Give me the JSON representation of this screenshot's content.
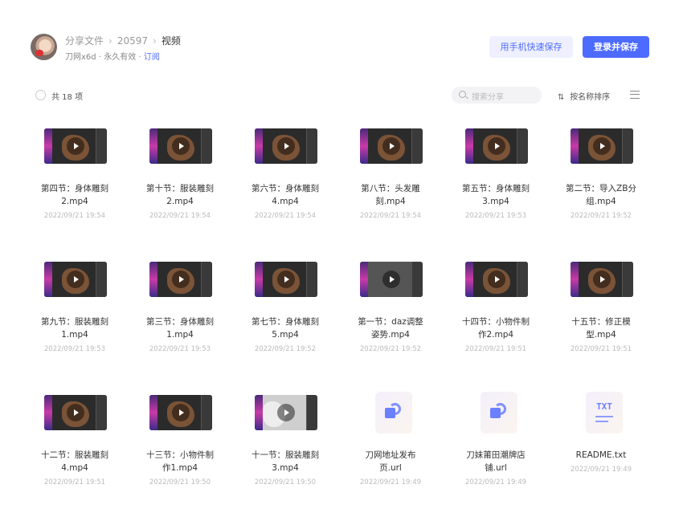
{
  "header": {
    "breadcrumb": [
      "分享文件",
      "20597",
      "视频"
    ],
    "breadcrumb_separator": "›",
    "owner": "刀网x6d",
    "validity": "永久有效",
    "meta_separator": "·",
    "subscribe": "订阅",
    "quick_save_label": "用手机快速保存",
    "save_label": "登录并保存"
  },
  "toolbar": {
    "count_label": "共 18 项",
    "search_placeholder": "搜索分享",
    "sort_icon": "⇅",
    "sort_label": "按名称排序"
  },
  "files": [
    {
      "name_line1": "第四节：身体雕刻",
      "name_line2": "2.mp4",
      "date": "2022/09/21 19:54",
      "type": "video"
    },
    {
      "name_line1": "第十节：服装雕刻",
      "name_line2": "2.mp4",
      "date": "2022/09/21 19:54",
      "type": "video"
    },
    {
      "name_line1": "第六节：身体雕刻",
      "name_line2": "4.mp4",
      "date": "2022/09/21 19:54",
      "type": "video"
    },
    {
      "name_line1": "第八节：头发雕",
      "name_line2": "刻.mp4",
      "date": "2022/09/21 19:54",
      "type": "video"
    },
    {
      "name_line1": "第五节：身体雕刻",
      "name_line2": "3.mp4",
      "date": "2022/09/21 19:53",
      "type": "video"
    },
    {
      "name_line1": "第二节：导入ZB分",
      "name_line2": "组.mp4",
      "date": "2022/09/21 19:52",
      "type": "video"
    },
    {
      "name_line1": "第九节：服装雕刻",
      "name_line2": "1.mp4",
      "date": "2022/09/21 19:53",
      "type": "video"
    },
    {
      "name_line1": "第三节：身体雕刻",
      "name_line2": "1.mp4",
      "date": "2022/09/21 19:53",
      "type": "video"
    },
    {
      "name_line1": "第七节：身体雕刻",
      "name_line2": "5.mp4",
      "date": "2022/09/21 19:52",
      "type": "video"
    },
    {
      "name_line1": "第一节：daz调整",
      "name_line2": "姿势.mp4",
      "date": "2022/09/21 19:52",
      "type": "video"
    },
    {
      "name_line1": "十四节：小物件制",
      "name_line2": "作2.mp4",
      "date": "2022/09/21 19:51",
      "type": "video"
    },
    {
      "name_line1": "十五节：修正模",
      "name_line2": "型.mp4",
      "date": "2022/09/21 19:51",
      "type": "video"
    },
    {
      "name_line1": "十二节：服装雕刻",
      "name_line2": "4.mp4",
      "date": "2022/09/21 19:51",
      "type": "video"
    },
    {
      "name_line1": "十三节：小物件制",
      "name_line2": "作1.mp4",
      "date": "2022/09/21 19:50",
      "type": "video"
    },
    {
      "name_line1": "十一节：服装雕刻",
      "name_line2": "3.mp4",
      "date": "2022/09/21 19:50",
      "type": "video"
    },
    {
      "name_line1": "刀网地址发布",
      "name_line2": "页.url",
      "date": "2022/09/21 19:49",
      "type": "url"
    },
    {
      "name_line1": "刀妹莆田潮牌店",
      "name_line2": "铺.url",
      "date": "2022/09/21 19:49",
      "type": "url"
    },
    {
      "name_line1": "README.txt",
      "name_line2": "",
      "date": "2022/09/21 19:49",
      "type": "txt",
      "icon_text": "TXT"
    }
  ],
  "colors": {
    "accent": "#4d6bff",
    "accent_light": "#eef0ff"
  }
}
